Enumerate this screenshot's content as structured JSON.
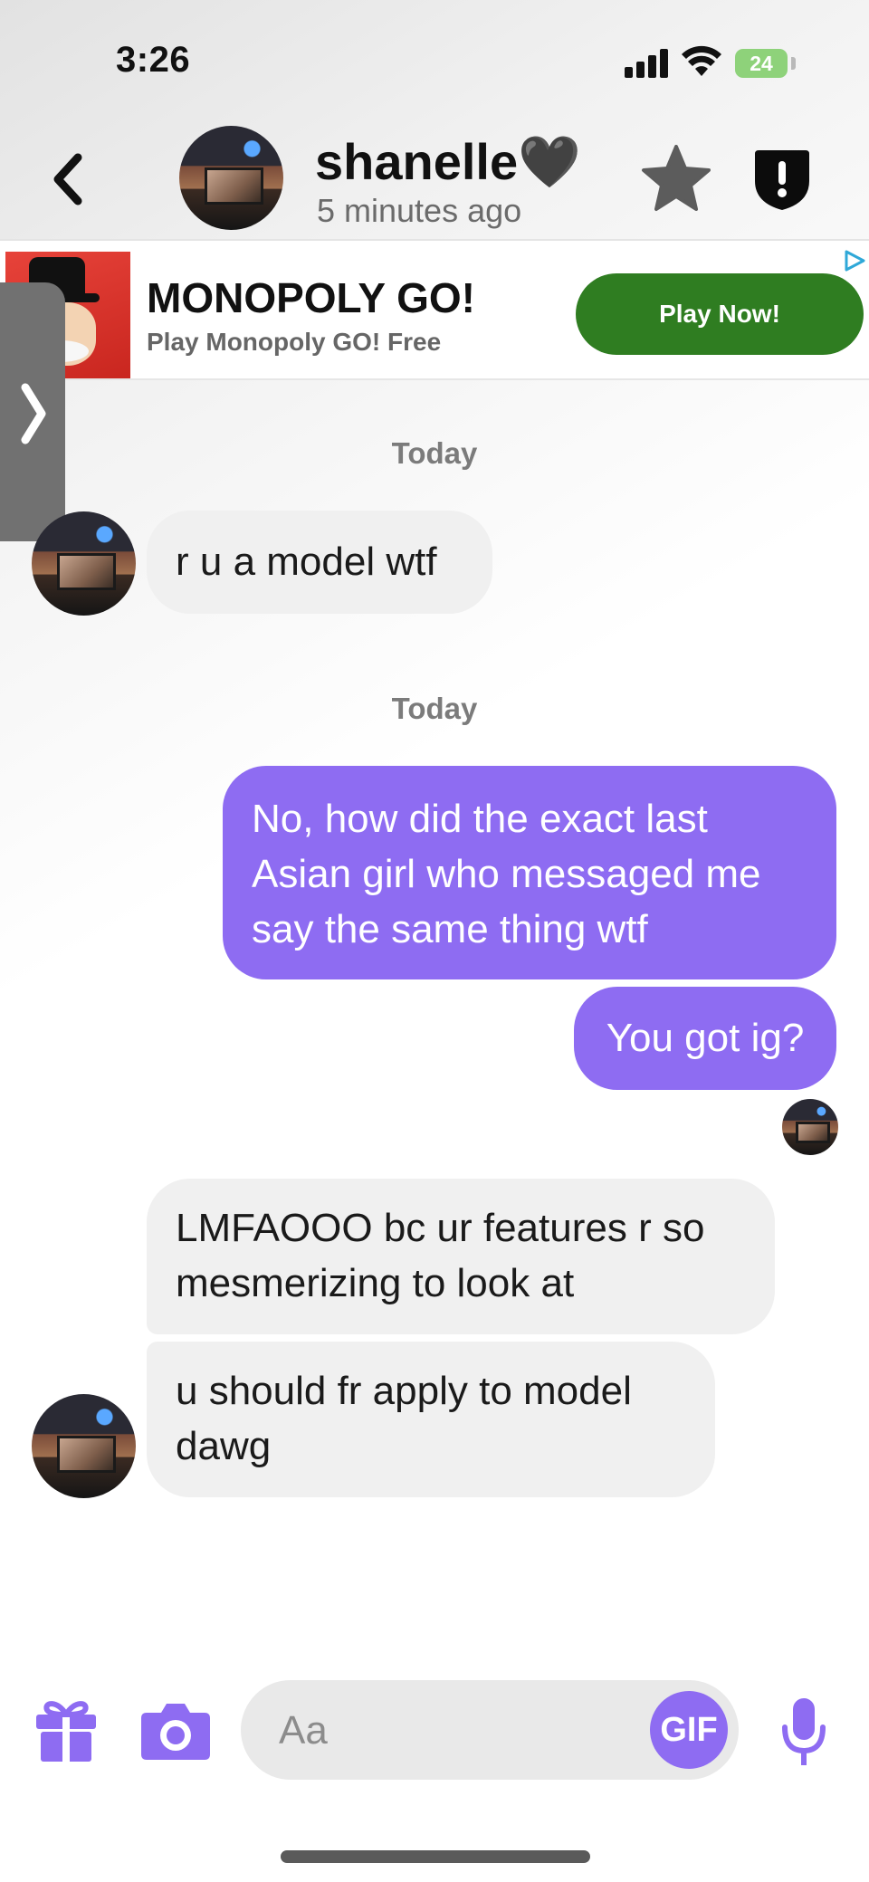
{
  "status_bar": {
    "time": "3:26",
    "battery": "24"
  },
  "header": {
    "contact_name": "shanelle🖤",
    "last_seen": "5 minutes ago",
    "icons": [
      "back-chevron-icon",
      "star-icon",
      "shield-alert-icon"
    ]
  },
  "ad": {
    "title": "MONOPOLY GO!",
    "subtitle": "Play Monopoly GO! Free",
    "cta_label": "Play Now!",
    "cta_color": "#2f7d21"
  },
  "conversation": {
    "date_labels": [
      "Today",
      "Today"
    ],
    "messages": [
      {
        "direction": "in",
        "text": "r u a model wtf"
      },
      {
        "direction": "out",
        "lines": [
          "No, how did the exact last",
          "Asian girl who messaged me",
          "say the same thing wtf"
        ]
      },
      {
        "direction": "out",
        "text": "You got ig?"
      },
      {
        "direction": "in",
        "lines": [
          "LMFAOOO bc ur features r so",
          "mesmerizing to look at"
        ]
      },
      {
        "direction": "in",
        "lines": [
          "u should fr apply to model",
          "dawg"
        ]
      }
    ]
  },
  "composer": {
    "placeholder": "Aa",
    "gif_label": "GIF",
    "accent_color": "#8e6cf2",
    "icons": [
      "gift-icon",
      "camera-icon",
      "microphone-icon"
    ]
  }
}
